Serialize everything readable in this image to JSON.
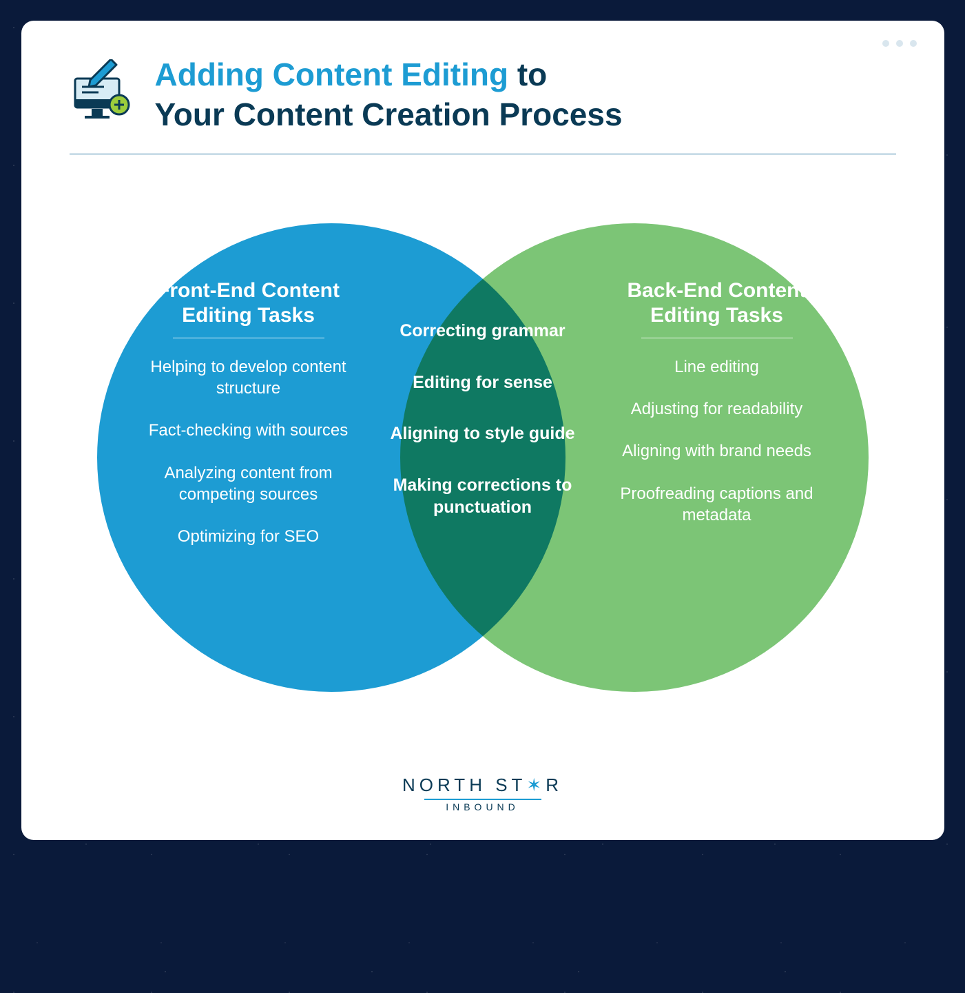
{
  "title": {
    "accent": "Adding Content Editing",
    "connector": " to ",
    "rest": "Your Content Creation Process"
  },
  "venn": {
    "left": {
      "heading": "Front-End Content Editing Tasks",
      "items": [
        "Helping to develop content structure",
        "Fact-checking with sources",
        "Analyzing content from competing sources",
        "Optimizing for SEO"
      ]
    },
    "middle": {
      "items": [
        "Correcting grammar",
        "Editing for sense",
        "Aligning to style guide",
        "Making corrections to punctuation"
      ]
    },
    "right": {
      "heading": "Back-End Content Editing Tasks",
      "items": [
        "Line editing",
        "Adjusting for readability",
        "Aligning with brand needs",
        "Proofreading captions and metadata"
      ]
    }
  },
  "footer": {
    "brand_left": "NORTH ST",
    "brand_right": "R",
    "brand_sub": "INBOUND"
  },
  "colors": {
    "left_circle": "#1d9cd3",
    "right_circle": "#7cc576",
    "dark": "#0a3a55"
  }
}
